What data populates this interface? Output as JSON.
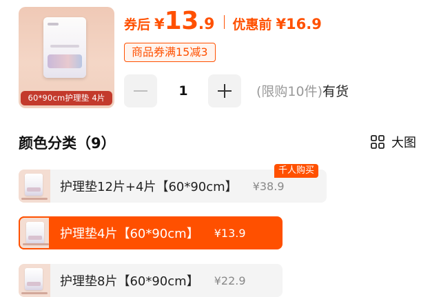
{
  "product": {
    "thumb_label": "60*90cm护理垫 4片",
    "coupon_price_label": "券后",
    "currency": "¥",
    "coupon_price_int": "13",
    "coupon_price_dec": ".9",
    "original_price_label": "优惠前",
    "original_price": "¥16.9",
    "coupon_tag": "商品券满15减3"
  },
  "quantity": {
    "value": "1",
    "limit_text": "(限购10件)",
    "stock_text": "有货"
  },
  "section": {
    "title": "颜色分类（9）",
    "view_toggle_label": "大图"
  },
  "options": [
    {
      "name": "护理垫12片+4片【60*90cm】",
      "price": "¥38.9",
      "badge": "千人购买",
      "selected": false
    },
    {
      "name": "护理垫4片【60*90cm】",
      "price": "¥13.9",
      "selected": true
    },
    {
      "name": "护理垫8片【60*90cm】",
      "price": "¥22.9",
      "selected": false
    }
  ],
  "colors": {
    "accent": "#ff5000",
    "thumb_label_bg": "#c33a2c",
    "option_bg": "#f4f4f4"
  },
  "icons": {
    "minus": "minus-icon",
    "plus": "plus-icon",
    "grid": "grid-view-icon"
  }
}
